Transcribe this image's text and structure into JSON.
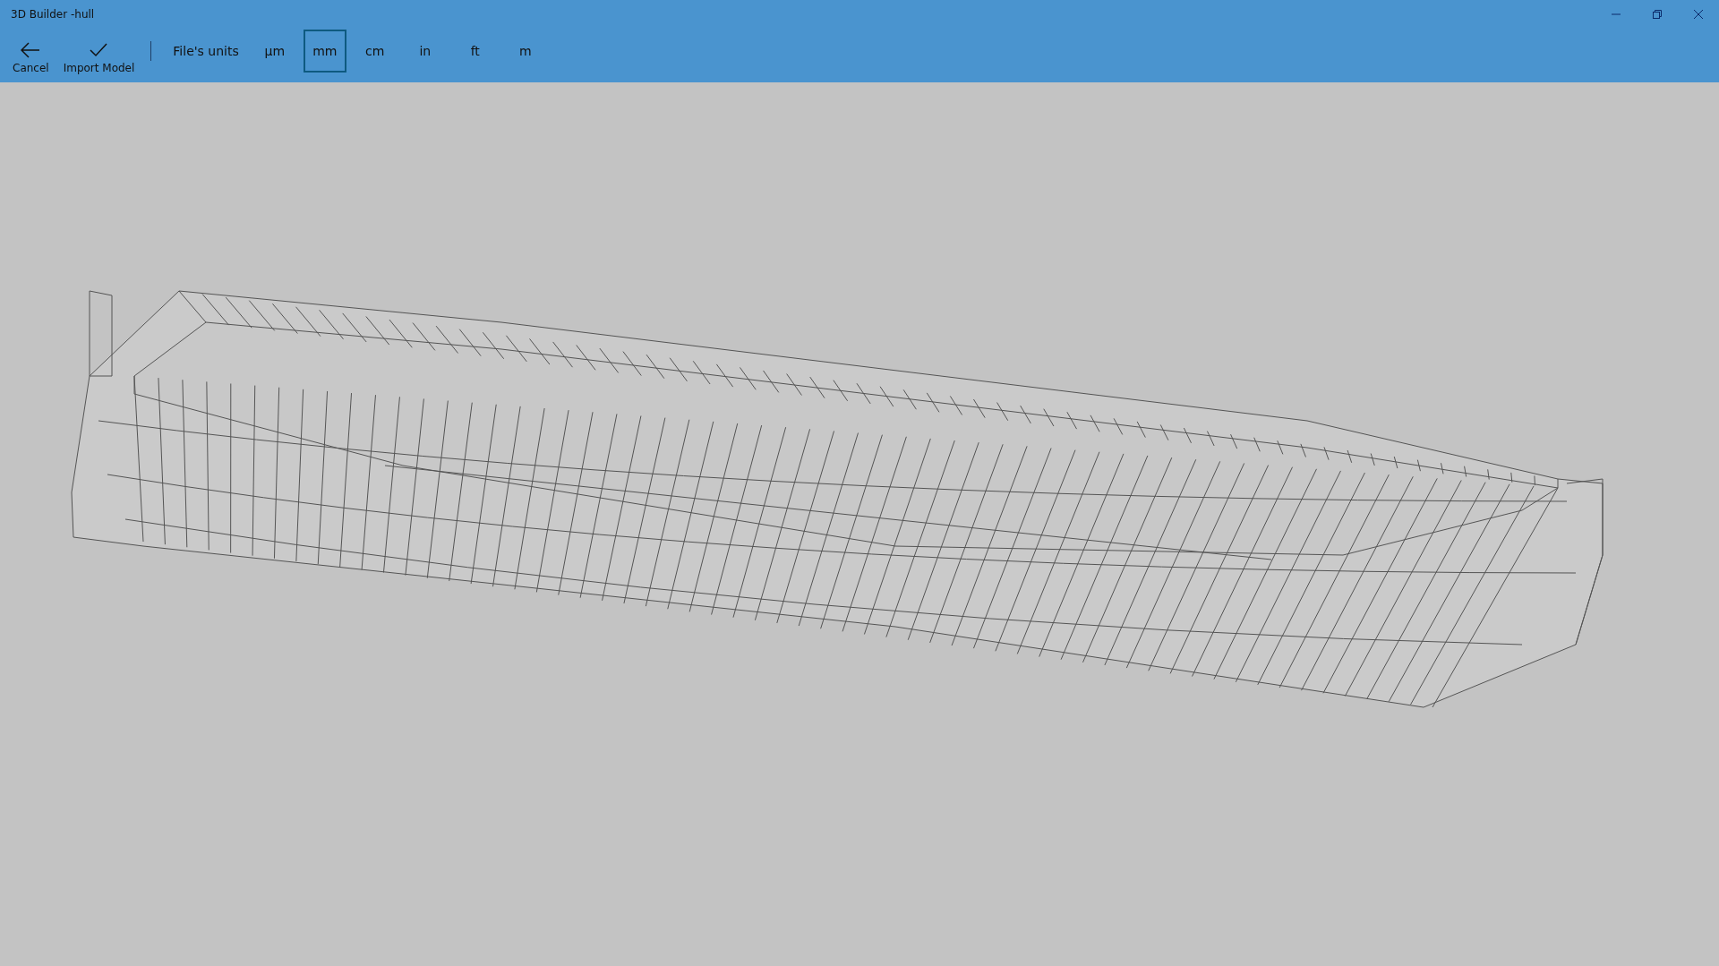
{
  "window": {
    "title": "3D Builder -hull"
  },
  "actions": [
    {
      "kind": "cancel",
      "label": "Cancel"
    },
    {
      "kind": "import",
      "label": "Import Model"
    }
  ],
  "units": [
    {
      "label": "File's units",
      "selected": false
    },
    {
      "label": "µm",
      "selected": false
    },
    {
      "label": "mm",
      "selected": true
    },
    {
      "label": "cm",
      "selected": false
    },
    {
      "label": "in",
      "selected": false
    },
    {
      "label": "ft",
      "selected": false
    },
    {
      "label": "m",
      "selected": false
    }
  ]
}
